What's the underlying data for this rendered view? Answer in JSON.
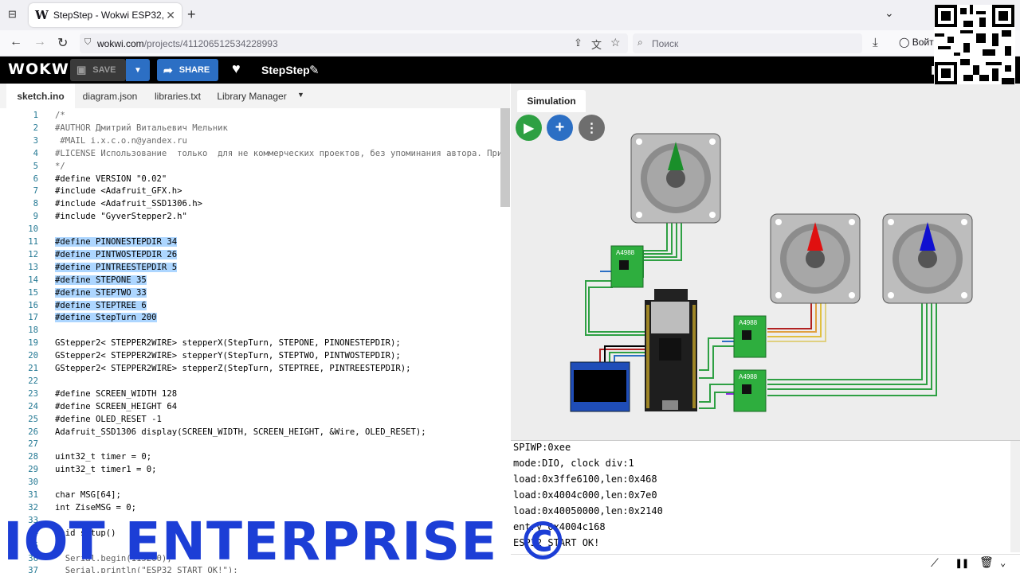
{
  "browser": {
    "tab_title": "StepStep - Wokwi ESP32, STM3",
    "tab_favicon": "W",
    "url_domain": "wokwi.com",
    "url_path": "/projects/411206512534228993",
    "search_placeholder": "Поиск",
    "signin": "Войти"
  },
  "wokwi": {
    "logo": "WOKWI",
    "save_label": "SAVE",
    "share_label": "SHARE",
    "project_name": "StepStep"
  },
  "editor": {
    "tabs": [
      "sketch.ino",
      "diagram.json",
      "libraries.txt",
      "Library Manager"
    ],
    "lines": [
      "/*",
      "#AUTHOR Дмитрий Витальевич Мельник",
      " #MAIL i.x.c.o.n@yandex.ru",
      "#LICENSE Использование  только  для не коммерческих проектов, без упоминания автора. При",
      "*/",
      "#define VERSION \"0.02\"",
      "#include <Adafruit_GFX.h>",
      "#include <Adafruit_SSD1306.h>",
      "#include \"GyverStepper2.h\"",
      "",
      "#define PINONESTEPDIR 34",
      "#define PINTWOSTEPDIR 26",
      "#define PINTREESTEPDIR 5",
      "#define STEPONE 35",
      "#define STEPTWO 33",
      "#define STEPTREE 6",
      "#define StepTurn 200",
      "",
      "GStepper2< STEPPER2WIRE> stepperX(StepTurn, STEPONE, PINONESTEPDIR);",
      "GStepper2< STEPPER2WIRE> stepperY(StepTurn, STEPTWO, PINTWOSTEPDIR);",
      "GStepper2< STEPPER2WIRE> stepperZ(StepTurn, STEPTREE, PINTREESTEPDIR);",
      "",
      "#define SCREEN_WIDTH 128",
      "#define SCREEN_HEIGHT 64",
      "#define OLED_RESET -1",
      "Adafruit_SSD1306 display(SCREEN_WIDTH, SCREEN_HEIGHT, &Wire, OLED_RESET);",
      "",
      "uint32_t timer = 0;",
      "uint32_t timer1 = 0;",
      "",
      "char MSG[64];",
      "int ZiseMSG = 0;",
      "",
      "void setup()",
      "",
      "  Serial.begin(115200);",
      "  Serial.println(\"ESP32 START OK!\");"
    ],
    "highlighted_lines": [
      11,
      12,
      13,
      14,
      15,
      16,
      17
    ]
  },
  "simulation": {
    "tab_label": "Simulation",
    "driver_label": "A4988",
    "needle_colors": [
      "#1a8f2a",
      "#e01010",
      "#1010d0"
    ]
  },
  "serial": {
    "lines": [
      "SPIWP:0xee",
      "mode:DIO, clock div:1",
      "load:0x3ffe6100,len:0x468",
      "load:0x4004c000,len:0x7e0",
      "load:0x40050000,len:0x2140",
      "entry 0x4004c168",
      "ESP32 START OK!"
    ]
  },
  "watermark": "IOT ENTERPRISE ©",
  "colors": {
    "accent": "#2c6fc4",
    "play": "#2ea043",
    "watermark": "#1c3ed6"
  }
}
